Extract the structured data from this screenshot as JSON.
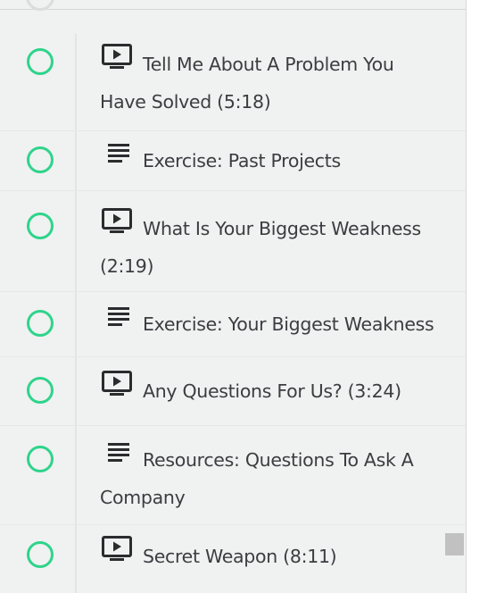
{
  "lessons": [
    {
      "type": "video",
      "title": "Tell Me About A Problem You Have Solved (5:18)"
    },
    {
      "type": "text",
      "title": "Exercise: Past Projects"
    },
    {
      "type": "video",
      "title": "What Is Your Biggest Weakness (2:19)"
    },
    {
      "type": "text",
      "title": "Exercise: Your Biggest Weakness"
    },
    {
      "type": "video",
      "title": "Any Questions For Us? (3:24)"
    },
    {
      "type": "text",
      "title": "Resources: Questions To Ask A Company"
    },
    {
      "type": "video",
      "title": "Secret Weapon (8:11)"
    }
  ],
  "icons": {
    "video": "video-icon",
    "text": "text-lines-icon",
    "status": "incomplete-circle-icon"
  },
  "colors": {
    "accent": "#2ed48b",
    "text": "#3b3d40",
    "background": "#f0f1f1"
  }
}
